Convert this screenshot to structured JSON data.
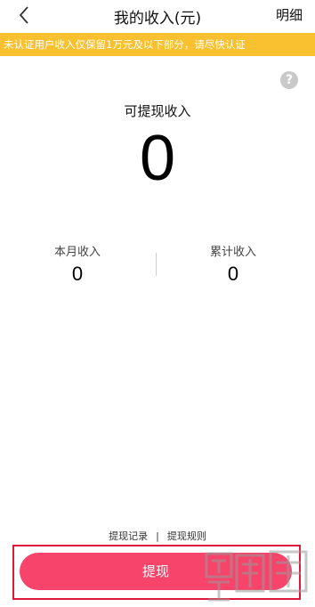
{
  "header": {
    "title": "我的收入(元)",
    "detail_label": "明细",
    "back_icon": "chevron-left-icon"
  },
  "notice": {
    "text": "未认证用户收入仅保留1万元及以下部分，请尽快认证",
    "color": "#f9c12f"
  },
  "help_icon": "question-circle-icon",
  "withdrawable": {
    "label": "可提现收入",
    "amount": "0"
  },
  "stats": {
    "month_label": "本月收入",
    "month_value": "0",
    "total_label": "累计收入",
    "total_value": "0"
  },
  "links": {
    "record": "提现记录",
    "separator": "|",
    "rules": "提现规则"
  },
  "withdraw_button": {
    "label": "提现",
    "color": "#f6446b"
  },
  "highlight_color": "#e0173b"
}
